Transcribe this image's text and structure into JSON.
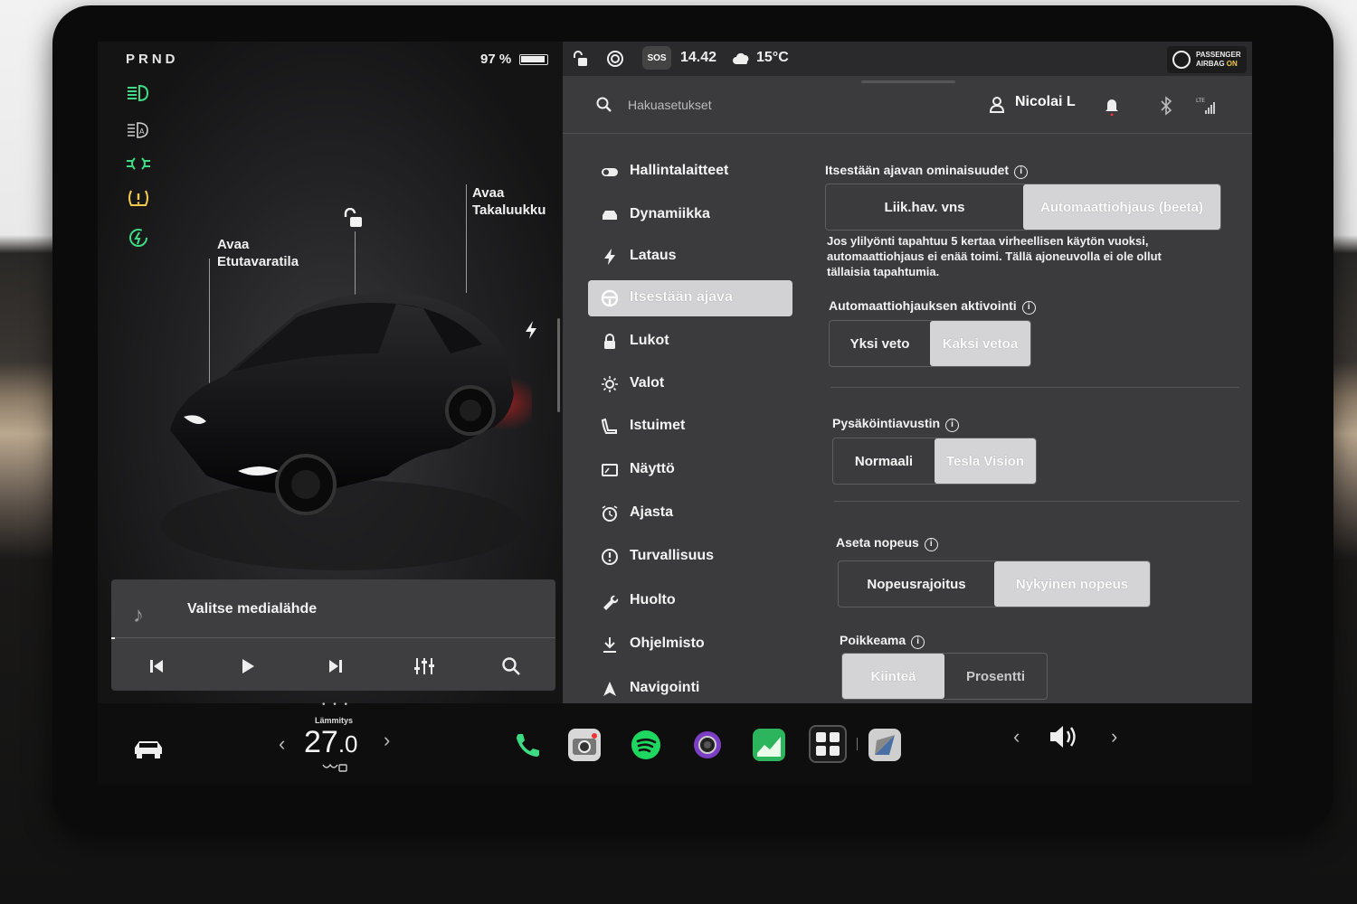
{
  "drive": {
    "gear": "PRND",
    "battery": "97 %"
  },
  "car": {
    "frunk_label_1": "Avaa",
    "frunk_label_2": "Etutavaratila",
    "trunk_label_1": "Avaa",
    "trunk_label_2": "Takaluukku"
  },
  "media": {
    "source": "Valitse medialähde"
  },
  "status": {
    "time": "14.42",
    "temperature": "15°C",
    "sos": "SOS",
    "airbag_line1": "PASSENGER",
    "airbag_line2": "AIRBAG",
    "airbag_state": "ON"
  },
  "search": {
    "placeholder": "Hakuasetukset"
  },
  "user": {
    "name": "Nicolai L"
  },
  "nav": {
    "items": [
      {
        "label": "Hallintalaitteet",
        "icon": "toggle-icon"
      },
      {
        "label": "Dynamiikka",
        "icon": "car-front-icon"
      },
      {
        "label": "Lataus",
        "icon": "bolt-icon"
      },
      {
        "label": "Itsestään ajava",
        "icon": "steering-wheel-icon",
        "active": true
      },
      {
        "label": "Lukot",
        "icon": "lock-icon"
      },
      {
        "label": "Valot",
        "icon": "sun-icon"
      },
      {
        "label": "Istuimet",
        "icon": "seat-icon"
      },
      {
        "label": "Näyttö",
        "icon": "display-icon"
      },
      {
        "label": "Ajasta",
        "icon": "alarm-clock-icon"
      },
      {
        "label": "Turvallisuus",
        "icon": "alert-circle-icon"
      },
      {
        "label": "Huolto",
        "icon": "wrench-icon"
      },
      {
        "label": "Ohjelmisto",
        "icon": "download-icon"
      },
      {
        "label": "Navigointi",
        "icon": "navigation-icon"
      }
    ]
  },
  "autopilot": {
    "features_title": "Itsestään ajavan ominaisuudet",
    "features_options": [
      "Liik.hav. vns",
      "Automaattiohjaus (beeta)"
    ],
    "features_selected": 1,
    "description": "Jos ylilyönti tapahtuu 5 kertaa virheellisen käytön vuoksi, automaattiohjaus ei enää toimi. Tällä ajoneuvolla ei ole ollut tällaisia tapahtumia.",
    "activation_title": "Automaattiohjauksen aktivointi",
    "activation_options": [
      "Yksi veto",
      "Kaksi vetoa"
    ],
    "activation_selected": 1,
    "parking_title": "Pysäköintiavustin",
    "parking_options": [
      "Normaali",
      "Tesla Vision"
    ],
    "parking_selected": 1,
    "speed_title": "Aseta nopeus",
    "speed_options": [
      "Nopeusrajoitus",
      "Nykyinen nopeus"
    ],
    "speed_selected": 1,
    "offset_title": "Poikkeama",
    "offset_options": [
      "Kiinteä",
      "Prosentti"
    ],
    "offset_selected": 0
  },
  "climate": {
    "label": "Lämmitys",
    "temp_whole": "27",
    "temp_decimal": ".0"
  },
  "colors": {
    "accent_green": "#3ddc84",
    "tell_yellow": "#f2c94c",
    "selected": "#d4d4d6"
  }
}
